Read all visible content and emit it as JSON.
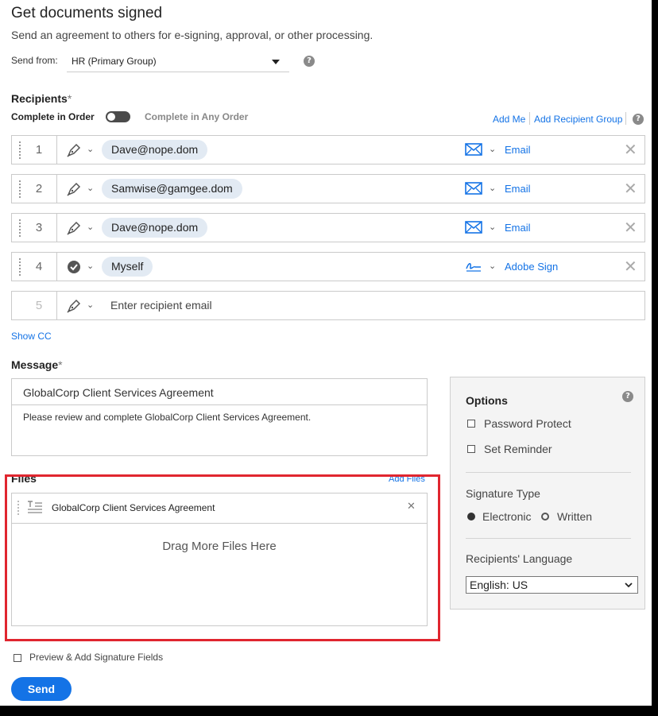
{
  "header": {
    "title": "Get documents signed",
    "subtitle": "Send an agreement to others for e-signing, approval, or other processing."
  },
  "send_from": {
    "label": "Send from:",
    "value": "HR (Primary Group)"
  },
  "recipients": {
    "label": "Recipients",
    "required_mark": "*",
    "order_label": "Complete in Order",
    "any_order_label": "Complete in Any Order",
    "add_me": "Add Me",
    "add_group": "Add Recipient Group",
    "rows": [
      {
        "num": "1",
        "email": "Dave@nope.dom",
        "delivery": "Email",
        "role_icon": "signer-pen-icon"
      },
      {
        "num": "2",
        "email": "Samwise@gamgee.dom",
        "delivery": "Email",
        "role_icon": "signer-pen-icon"
      },
      {
        "num": "3",
        "email": "Dave@nope.dom",
        "delivery": "Email",
        "role_icon": "signer-pen-icon"
      },
      {
        "num": "4",
        "email": "Myself",
        "delivery": "Adobe Sign",
        "role_icon": "check-circle-icon"
      }
    ],
    "new_row": {
      "num": "5",
      "placeholder": "Enter recipient email"
    },
    "show_cc": "Show CC"
  },
  "message": {
    "label": "Message",
    "required_mark": "*",
    "subject": "GlobalCorp Client Services Agreement",
    "body": "Please review and complete GlobalCorp Client Services Agreement."
  },
  "files": {
    "label": "Files",
    "add_files": "Add Files",
    "items": [
      {
        "name": "GlobalCorp Client Services Agreement"
      }
    ],
    "drop_text": "Drag More Files Here"
  },
  "options": {
    "title": "Options",
    "password_protect": "Password Protect",
    "set_reminder": "Set Reminder",
    "signature_type_label": "Signature Type",
    "electronic": "Electronic",
    "written": "Written",
    "signature_type_selected": "Electronic",
    "language_label": "Recipients' Language",
    "language_value": "English: US"
  },
  "footer": {
    "preview_label": "Preview & Add Signature Fields",
    "send_label": "Send"
  },
  "colors": {
    "accent": "#1473e6",
    "highlight": "#e0262f",
    "pill": "#e2eaf3"
  }
}
